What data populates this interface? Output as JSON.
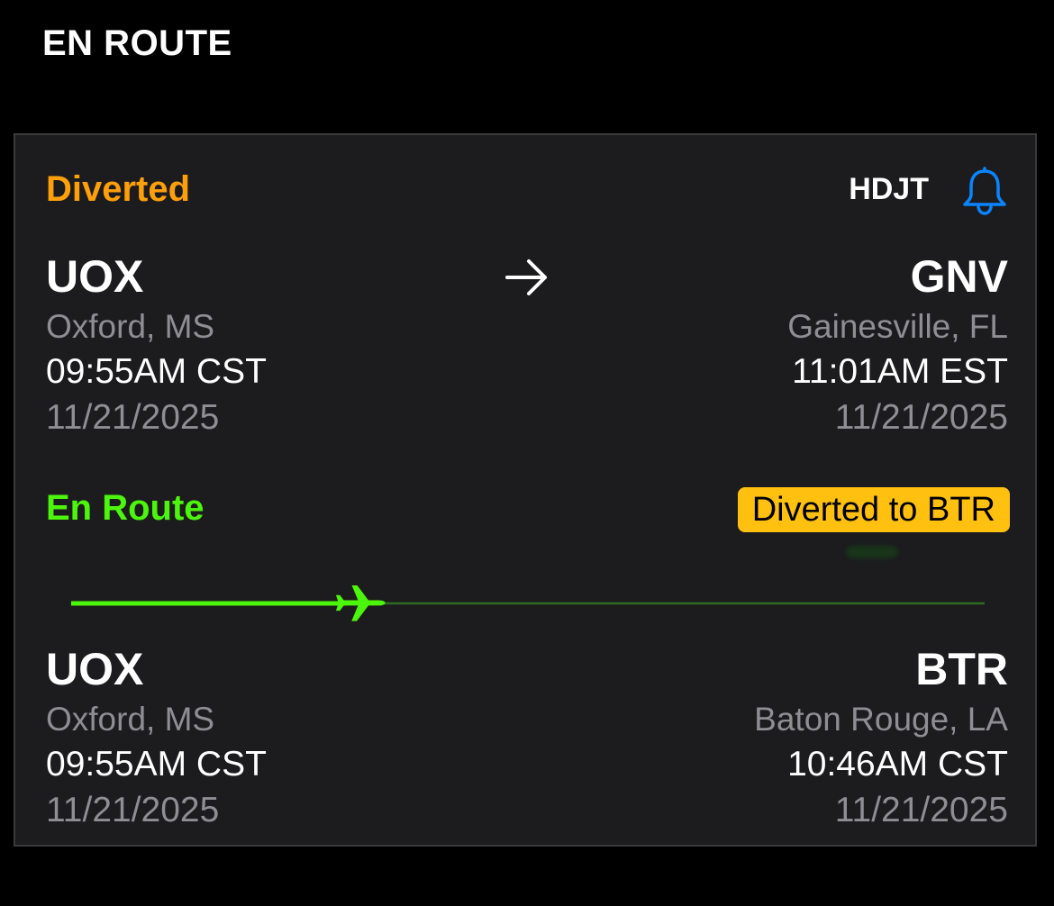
{
  "section_title": "EN ROUTE",
  "colors": {
    "diverted_orange": "#ff9f0a",
    "en_route_green": "#4cf50c",
    "badge_yellow": "#ffc00f",
    "bell_blue": "#0a84ff",
    "track_dim": "#2f6b22"
  },
  "flight": {
    "status": "Diverted",
    "tail_number": "HDJT",
    "alert_icon": "bell-icon",
    "route_icon": "arrow-right-icon"
  },
  "scheduled": {
    "origin": {
      "code": "UOX",
      "city": "Oxford, MS",
      "time": "09:55AM CST",
      "date": "11/21/2025"
    },
    "destination": {
      "code": "GNV",
      "city": "Gainesville, FL",
      "time": "11:01AM EST",
      "date": "11/21/2025"
    }
  },
  "progress": {
    "label": "En Route",
    "divert_badge": "Diverted to BTR",
    "fraction_complete": 0.3,
    "plane_icon": "airplane-icon"
  },
  "actual": {
    "origin": {
      "code": "UOX",
      "city": "Oxford, MS",
      "time": "09:55AM CST",
      "date": "11/21/2025"
    },
    "destination": {
      "code": "BTR",
      "city": "Baton Rouge, LA",
      "time": "10:46AM CST",
      "date": "11/21/2025"
    }
  }
}
